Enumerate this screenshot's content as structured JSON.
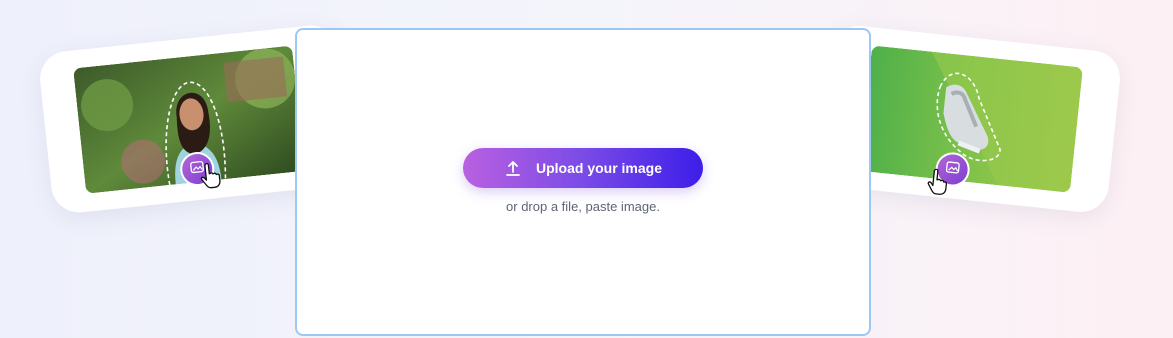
{
  "dropzone": {
    "upload_button_label": "Upload your image",
    "hint": "or drop a file, paste image."
  },
  "examples": [
    {
      "subject": "woman portrait",
      "icon": "image-icon"
    },
    {
      "subject": "sneaker",
      "icon": "image-icon"
    }
  ],
  "colors": {
    "button_gradient_start": "#b960e0",
    "button_gradient_end": "#3d1ee8",
    "dropzone_border": "#9cc8f3",
    "badge": "#8f4fd6"
  }
}
